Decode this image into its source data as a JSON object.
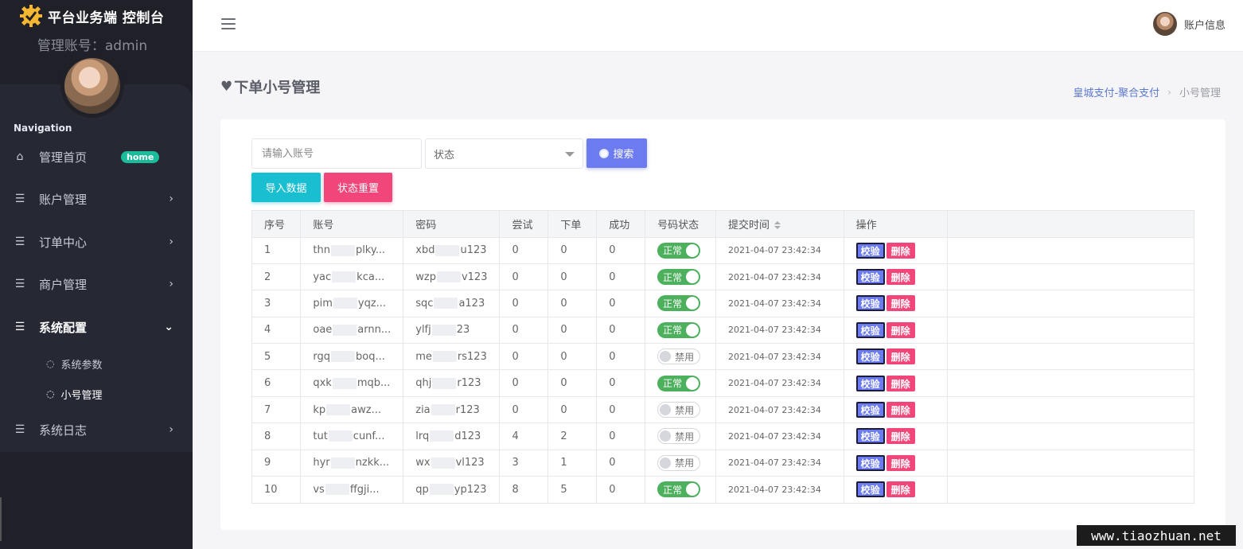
{
  "brand": {
    "title": "平台业务端 控制台",
    "admin_label": "管理账号：admin"
  },
  "sidebar": {
    "caption": "Navigation",
    "items": [
      {
        "label": "管理首页",
        "badge": "home"
      },
      {
        "label": "账户管理"
      },
      {
        "label": "订单中心"
      },
      {
        "label": "商户管理"
      },
      {
        "label": "系统配置"
      },
      {
        "label": "系统日志"
      }
    ],
    "sub_items": [
      {
        "label": "系统参数"
      },
      {
        "label": "小号管理"
      }
    ]
  },
  "topbar": {
    "account_label": "账户信息"
  },
  "page": {
    "title": "下单小号管理"
  },
  "breadcrumb": {
    "home": "皇城支付-聚合支付",
    "current": "小号管理"
  },
  "filters": {
    "account_placeholder": "请输入账号",
    "status_label": "状态",
    "search_label": "搜索",
    "import_label": "导入数据",
    "reset_label": "状态重置"
  },
  "table": {
    "headers": [
      "序号",
      "账号",
      "密码",
      "尝试",
      "下单",
      "成功",
      "号码状态",
      "提交时间",
      "操作"
    ],
    "verify_label": "校验",
    "delete_label": "删除",
    "rows": [
      {
        "idx": "1",
        "acc_a": "thn",
        "acc_b": "plky...",
        "pwd_a": "xbd",
        "pwd_b": "u123",
        "try": "0",
        "order": "0",
        "succ": "0",
        "state": "正常",
        "on": true,
        "time": "2021-04-07 23:42:34"
      },
      {
        "idx": "2",
        "acc_a": "yac",
        "acc_b": "kca...",
        "pwd_a": "wzp",
        "pwd_b": "v123",
        "try": "0",
        "order": "0",
        "succ": "0",
        "state": "正常",
        "on": true,
        "time": "2021-04-07 23:42:34"
      },
      {
        "idx": "3",
        "acc_a": "pim",
        "acc_b": "yqz...",
        "pwd_a": "sqc",
        "pwd_b": "a123",
        "try": "0",
        "order": "0",
        "succ": "0",
        "state": "正常",
        "on": true,
        "time": "2021-04-07 23:42:34"
      },
      {
        "idx": "4",
        "acc_a": "oae",
        "acc_b": "arnn...",
        "pwd_a": "ylfj",
        "pwd_b": "23",
        "try": "0",
        "order": "0",
        "succ": "0",
        "state": "正常",
        "on": true,
        "time": "2021-04-07 23:42:34"
      },
      {
        "idx": "5",
        "acc_a": "rgq",
        "acc_b": "boq...",
        "pwd_a": "me",
        "pwd_b": "rs123",
        "try": "0",
        "order": "0",
        "succ": "0",
        "state": "禁用",
        "on": false,
        "time": "2021-04-07 23:42:34"
      },
      {
        "idx": "6",
        "acc_a": "qxk",
        "acc_b": "mqb...",
        "pwd_a": "qhj",
        "pwd_b": "r123",
        "try": "0",
        "order": "0",
        "succ": "0",
        "state": "正常",
        "on": true,
        "time": "2021-04-07 23:42:34"
      },
      {
        "idx": "7",
        "acc_a": "kp",
        "acc_b": "awz...",
        "pwd_a": "zia",
        "pwd_b": "r123",
        "try": "0",
        "order": "0",
        "succ": "0",
        "state": "禁用",
        "on": false,
        "time": "2021-04-07 23:42:34"
      },
      {
        "idx": "8",
        "acc_a": "tut",
        "acc_b": "cunf...",
        "pwd_a": "lrq",
        "pwd_b": "d123",
        "try": "4",
        "order": "2",
        "succ": "0",
        "state": "禁用",
        "on": false,
        "time": "2021-04-07 23:42:34"
      },
      {
        "idx": "9",
        "acc_a": "hyr",
        "acc_b": "nzkk...",
        "pwd_a": "wx",
        "pwd_b": "vl123",
        "try": "3",
        "order": "1",
        "succ": "0",
        "state": "禁用",
        "on": false,
        "time": "2021-04-07 23:42:34"
      },
      {
        "idx": "10",
        "acc_a": "vs",
        "acc_b": "ffgji...",
        "pwd_a": "qp",
        "pwd_b": "yp123",
        "try": "8",
        "order": "5",
        "succ": "0",
        "state": "正常",
        "on": true,
        "time": "2021-04-07 23:42:34"
      }
    ]
  },
  "watermark": "www.tiaozhuan.net"
}
